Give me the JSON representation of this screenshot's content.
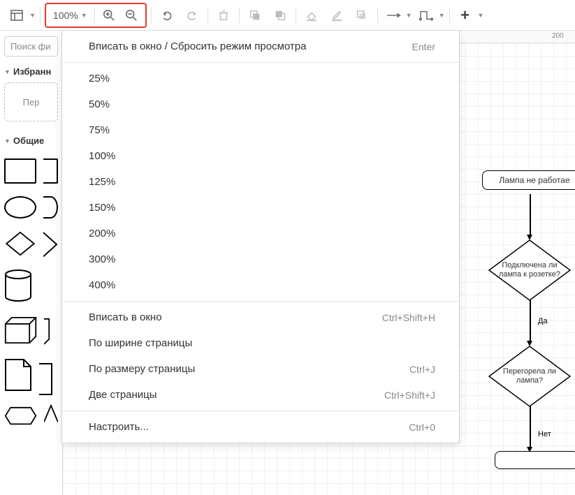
{
  "toolbar": {
    "zoom_value": "100%"
  },
  "sidebar": {
    "search_placeholder": "Поиск фи",
    "panels": {
      "favorites": "Избранн",
      "dropzone": "Пер",
      "common": "Общие"
    }
  },
  "ruler": {
    "tick_200": "200"
  },
  "flowchart": {
    "node1": "Лампа не работае",
    "node2": "Подключена ли\nлампа к\nрозетке?",
    "node3": "Перегорела ли\nлампа?",
    "edge_yes": "Да",
    "edge_no": "Нет"
  },
  "menu": {
    "fit_reset": {
      "label": "Вписать в окно / Сбросить режим просмотра",
      "shortcut": "Enter"
    },
    "levels": [
      "25%",
      "50%",
      "75%",
      "100%",
      "125%",
      "150%",
      "200%",
      "300%",
      "400%"
    ],
    "fit_window": {
      "label": "Вписать в окно",
      "shortcut": "Ctrl+Shift+H"
    },
    "fit_width": {
      "label": "По ширине страницы",
      "shortcut": ""
    },
    "fit_page": {
      "label": "По размеру страницы",
      "shortcut": "Ctrl+J"
    },
    "two_pages": {
      "label": "Две страницы",
      "shortcut": "Ctrl+Shift+J"
    },
    "custom": {
      "label": "Настроить...",
      "shortcut": "Ctrl+0"
    }
  }
}
